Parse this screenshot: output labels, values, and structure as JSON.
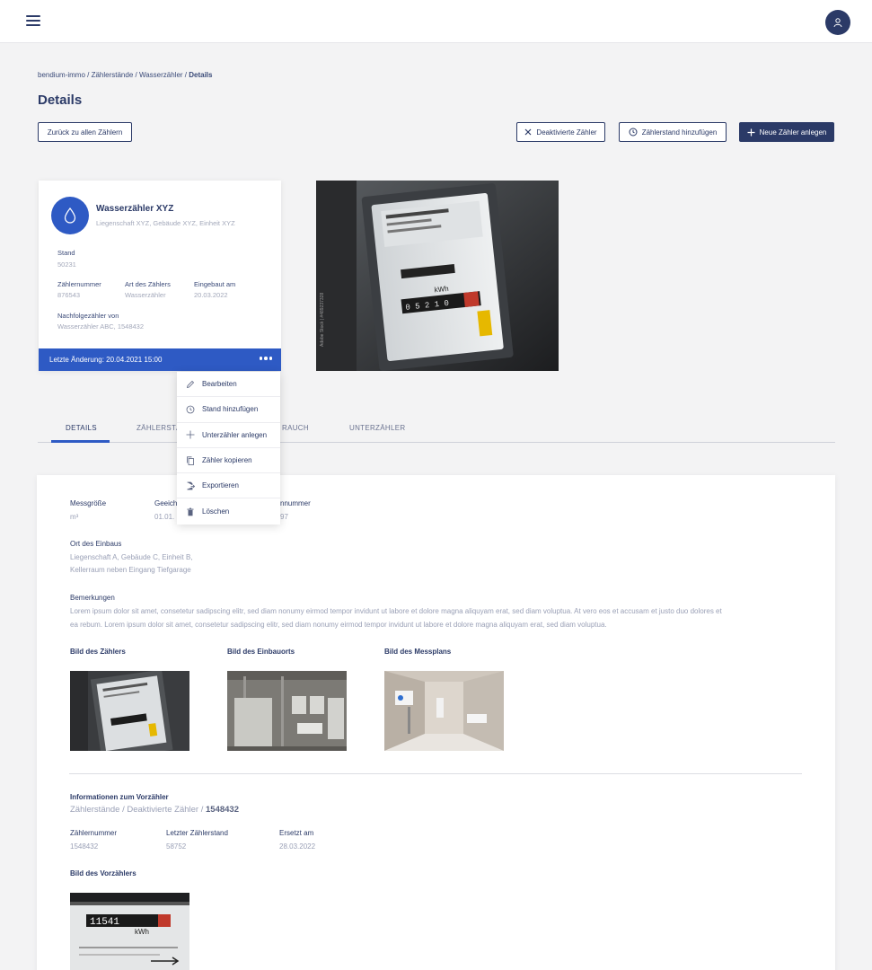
{
  "topbar": {
    "menu_icon": "hamburger-icon",
    "avatar_icon": "user-icon"
  },
  "breadcrumb": {
    "parts": [
      "bendium-immo",
      "Zählerstände",
      "Wasserzähler"
    ],
    "current": "Details",
    "separator": " / "
  },
  "page_title": "Details",
  "actions": {
    "back": "Zurück zu allen Zählern",
    "deactivated": "Deaktivierte Zähler",
    "add_reading": "Zählerstand hinzufügen",
    "new_meter": "Neue Zähler anlegen"
  },
  "card": {
    "title": "Wasserzähler XYZ",
    "subtitle": "Liegenschaft XYZ, Gebäude XYZ, Einheit XYZ",
    "stand_label": "Stand",
    "stand_value": "50231",
    "fields": [
      {
        "label": "Zählernummer",
        "value": "876543"
      },
      {
        "label": "Art des Zählers",
        "value": "Wasserzähler"
      },
      {
        "label": "Eingebaut am",
        "value": "20.03.2022"
      }
    ],
    "successor_label": "Nachfolgezähler von",
    "successor_value": "Wasserzähler ABC, 1548432",
    "footer": "Letzte Änderung: 20.04.2021 15:00",
    "icon": "water-drop-icon",
    "accent": "#2e5ac4"
  },
  "menu": {
    "items": [
      {
        "label": "Bearbeiten",
        "icon": "edit-icon"
      },
      {
        "label": "Stand hinzufügen",
        "icon": "history-icon"
      },
      {
        "label": "Unterzähler anlegen",
        "icon": "plus-icon"
      },
      {
        "label": "Zähler kopieren",
        "icon": "copy-icon"
      },
      {
        "label": "Exportieren",
        "icon": "export-icon"
      },
      {
        "label": "Löschen",
        "icon": "trash-icon"
      }
    ]
  },
  "tabs": {
    "items": [
      {
        "label": "DETAILS",
        "active": true
      },
      {
        "label": "ZÄHLERSTÄNDE"
      },
      {
        "label": "VERBRAUCH"
      },
      {
        "label": "UNTERZÄHLER"
      }
    ],
    "visible": {
      "details": "DETAILS",
      "zaehler": "ZÄHLERSTÄ",
      "verbrauch": "RAUCH",
      "unter": "UNTERZÄHLER"
    }
  },
  "details": {
    "messgroesse_label": "Messgröße",
    "messgroesse_value": "m³",
    "geeicht_label": "Geeich",
    "geeicht_value": "01.01.",
    "nummer_label": "nnummer",
    "nummer_value": "97",
    "ort_label": "Ort des Einbaus",
    "ort_line1": "Liegenschaft A, Gebäude C, Einheit B,",
    "ort_line2": "Kellerraum neben Eingang Tiefgarage",
    "bemerkungen_label": "Bemerkungen",
    "bemerkungen_line1": "Lorem ipsum dolor sit amet, consetetur sadipscing elitr, sed diam nonumy eirmod tempor invidunt ut labore et dolore magna aliquyam erat, sed diam voluptua. At vero eos et accusam et justo duo dolores et",
    "bemerkungen_line2": "ea rebum. Lorem ipsum dolor sit amet, consetetur sadipscing elitr, sed diam nonumy eirmod tempor invidunt ut labore et dolore magna aliquyam erat, sed diam voluptua.",
    "img1_label": "Bild des Zählers",
    "img2_label": "Bild des Einbauorts",
    "img3_label": "Bild des Messplans"
  },
  "previous": {
    "heading": "Informationen zum Vorzähler",
    "path": "Zählerstände / Deaktivierte Zähler / ",
    "path_current": "1548432",
    "fields": [
      {
        "label": "Zählernummer",
        "value": "1548432"
      },
      {
        "label": "Letzter Zählerstand",
        "value": "58752"
      },
      {
        "label": "Ersetzt am",
        "value": "28.03.2022"
      }
    ],
    "img_label": "Bild des Vorzählers",
    "meter_digits": "11541",
    "meter_unit": "kWh"
  },
  "photo": {
    "watermark": "Adobe Stock | #489237328",
    "display_unit": "kWh"
  }
}
